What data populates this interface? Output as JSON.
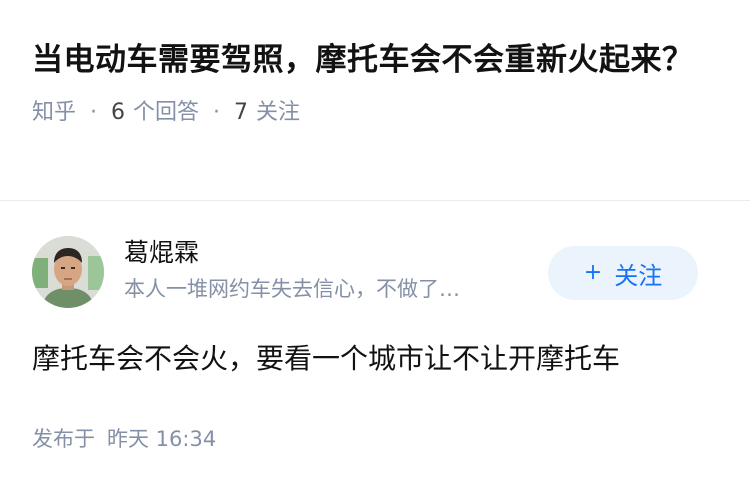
{
  "question": {
    "title": "当电动车需要驾照，摩托车会不会重新火起来？",
    "source": "知乎",
    "separator": "·",
    "answers_count": "6",
    "answers_label": "个回答",
    "followers_count": "7",
    "followers_label": "关注"
  },
  "author": {
    "name": "葛焜霖",
    "bio": "本人一堆网约车失去信心，不做了…",
    "avatar": "avatar-photo",
    "follow_label": "关注",
    "follow_icon": "plus-icon"
  },
  "answer": {
    "text": "摩托车会不会火，要看一个城市让不让开摩托车"
  },
  "published": {
    "label": "发布于",
    "time": "昨天 16:34"
  },
  "colors": {
    "accent": "#1772f6",
    "accent_bg": "#ebf3fd",
    "meta": "#8590a6",
    "text": "#121212"
  }
}
